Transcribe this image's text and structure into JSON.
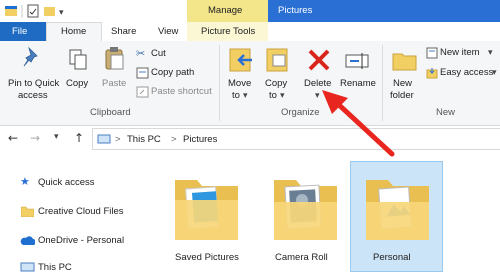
{
  "context_tab": {
    "label": "Manage",
    "color": "#f3e58a"
  },
  "window_title": "Pictures",
  "tabs": {
    "file": "File",
    "home": "Home",
    "share": "Share",
    "view": "View",
    "picture_tools": "Picture Tools"
  },
  "ribbon": {
    "clipboard": {
      "pin_line1": "Pin to Quick",
      "pin_line2": "access",
      "copy": "Copy",
      "paste": "Paste",
      "cut": "Cut",
      "copy_path": "Copy path",
      "paste_shortcut": "Paste shortcut",
      "group_label": "Clipboard"
    },
    "organize": {
      "move_to_line1": "Move",
      "move_to_line2": "to",
      "copy_to_line1": "Copy",
      "copy_to_line2": "to",
      "delete": "Delete",
      "rename": "Rename",
      "group_label": "Organize"
    },
    "new": {
      "new_folder_line1": "New",
      "new_folder_line2": "folder",
      "new_item": "New item",
      "easy_access": "Easy access",
      "group_label": "New"
    }
  },
  "address": {
    "separator": ">",
    "crumbs": [
      "This PC",
      "Pictures"
    ]
  },
  "nav_pane": {
    "items": [
      "Quick access",
      "Creative Cloud Files",
      "OneDrive - Personal",
      "This PC"
    ]
  },
  "folders": [
    {
      "label": "Saved Pictures"
    },
    {
      "label": "Camera Roll"
    },
    {
      "label": "Personal",
      "selected": true
    }
  ],
  "colors": {
    "accent": "#2a6fd4",
    "file_tab": "#1f6bc4",
    "folder": "#f2cf63",
    "delete_x": "#d9261c",
    "annotation_arrow": "#e8261f",
    "selection": "#cce4f7"
  }
}
